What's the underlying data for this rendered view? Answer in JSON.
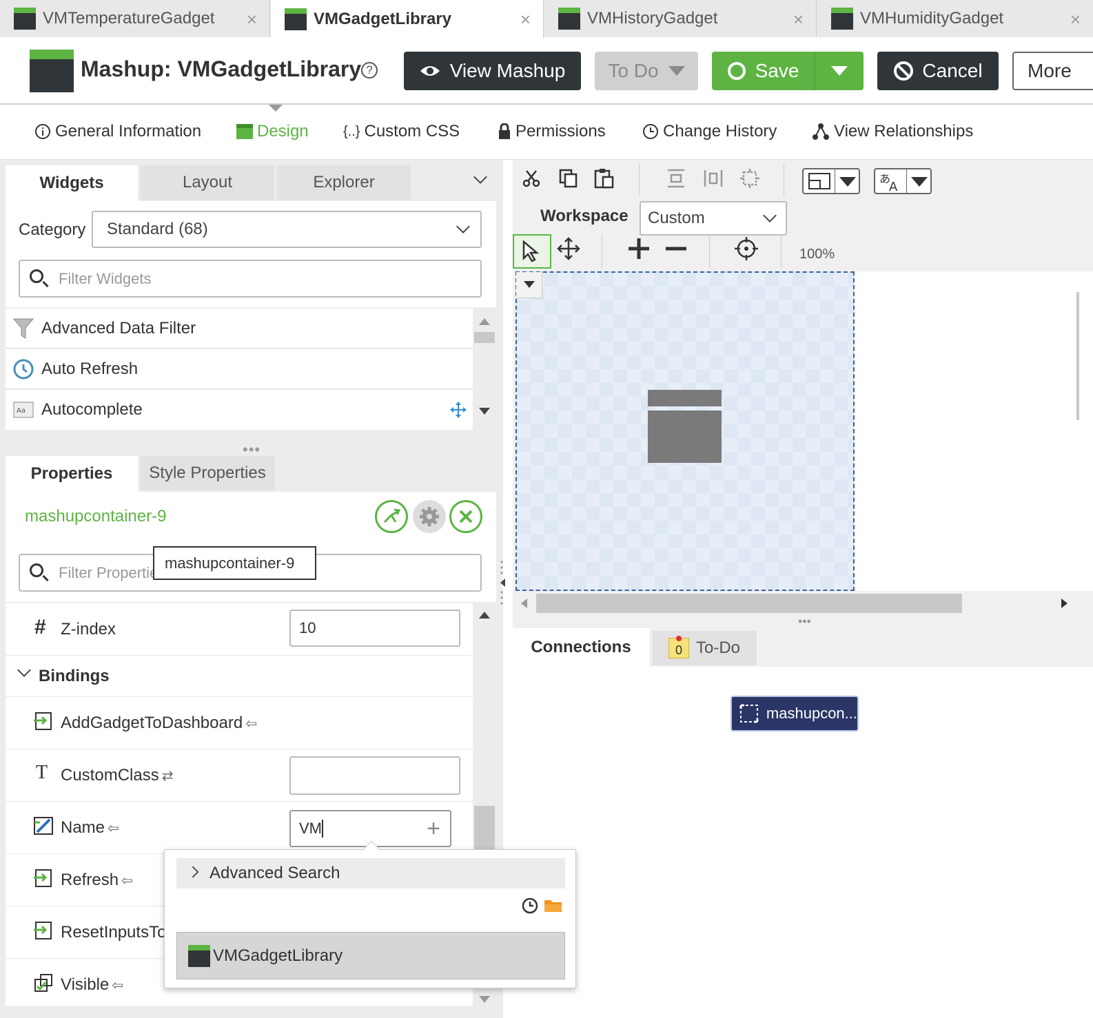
{
  "doc_tabs": [
    {
      "label": "VMTemperatureGadget",
      "close": "×"
    },
    {
      "label": "VMGadgetLibrary",
      "close": "×"
    },
    {
      "label": "VMHistoryGadget",
      "close": "×"
    },
    {
      "label": "VMHumidityGadget",
      "close": "×"
    }
  ],
  "header": {
    "title": "Mashup: VMGadgetLibrary",
    "help": "?",
    "view_mashup": "View Mashup",
    "todo": "To Do",
    "save": "Save",
    "cancel": "Cancel",
    "more": "More"
  },
  "subnav": {
    "items": [
      {
        "label": "General Information",
        "icon": "info-icon"
      },
      {
        "label": "Design",
        "icon": "design-icon"
      },
      {
        "label": "Custom CSS",
        "icon": "braces-icon",
        "prefix": "{..}"
      },
      {
        "label": "Permissions",
        "icon": "lock-icon"
      },
      {
        "label": "Change History",
        "icon": "clock-icon"
      },
      {
        "label": "View Relationships",
        "icon": "relationships-icon"
      }
    ]
  },
  "widgets_panel": {
    "tabs": [
      "Widgets",
      "Layout",
      "Explorer"
    ],
    "category_label": "Category",
    "category_value": "Standard (68)",
    "filter_placeholder": "Filter Widgets",
    "items": [
      "Advanced Data Filter",
      "Auto Refresh",
      "Autocomplete"
    ]
  },
  "properties_panel": {
    "tabs": [
      "Properties",
      "Style Properties"
    ],
    "selected_widget": "mashupcontainer-9",
    "filter_placeholder": "Filter Properties",
    "tooltip": "mashupcontainer-9",
    "zindex_label": "Z-index",
    "zindex_value": "10",
    "bindings_label": "Bindings",
    "bindings": [
      {
        "label": "AddGadgetToDashboard",
        "arrow": "⇦"
      },
      {
        "label": "CustomClass",
        "arrow": "⇄"
      },
      {
        "label": "Name",
        "arrow": "⇦",
        "value": "VM"
      },
      {
        "label": "Refresh",
        "arrow": "⇦"
      },
      {
        "label": "ResetInputsTo",
        "arrow": ""
      },
      {
        "label": "Visible",
        "arrow": "⇦"
      }
    ]
  },
  "name_dropdown": {
    "advanced_search": "Advanced Search",
    "result": "VMGadgetLibrary"
  },
  "workspace": {
    "label": "Workspace",
    "value": "Custom",
    "zoom": "100%"
  },
  "connections": {
    "tabs": [
      "Connections",
      "To-Do"
    ],
    "todo_count": "0",
    "node_label": "mashupcon..."
  },
  "colors": {
    "accent_green": "#5db443",
    "dark": "#2f3538",
    "node_blue": "#2b3566"
  }
}
